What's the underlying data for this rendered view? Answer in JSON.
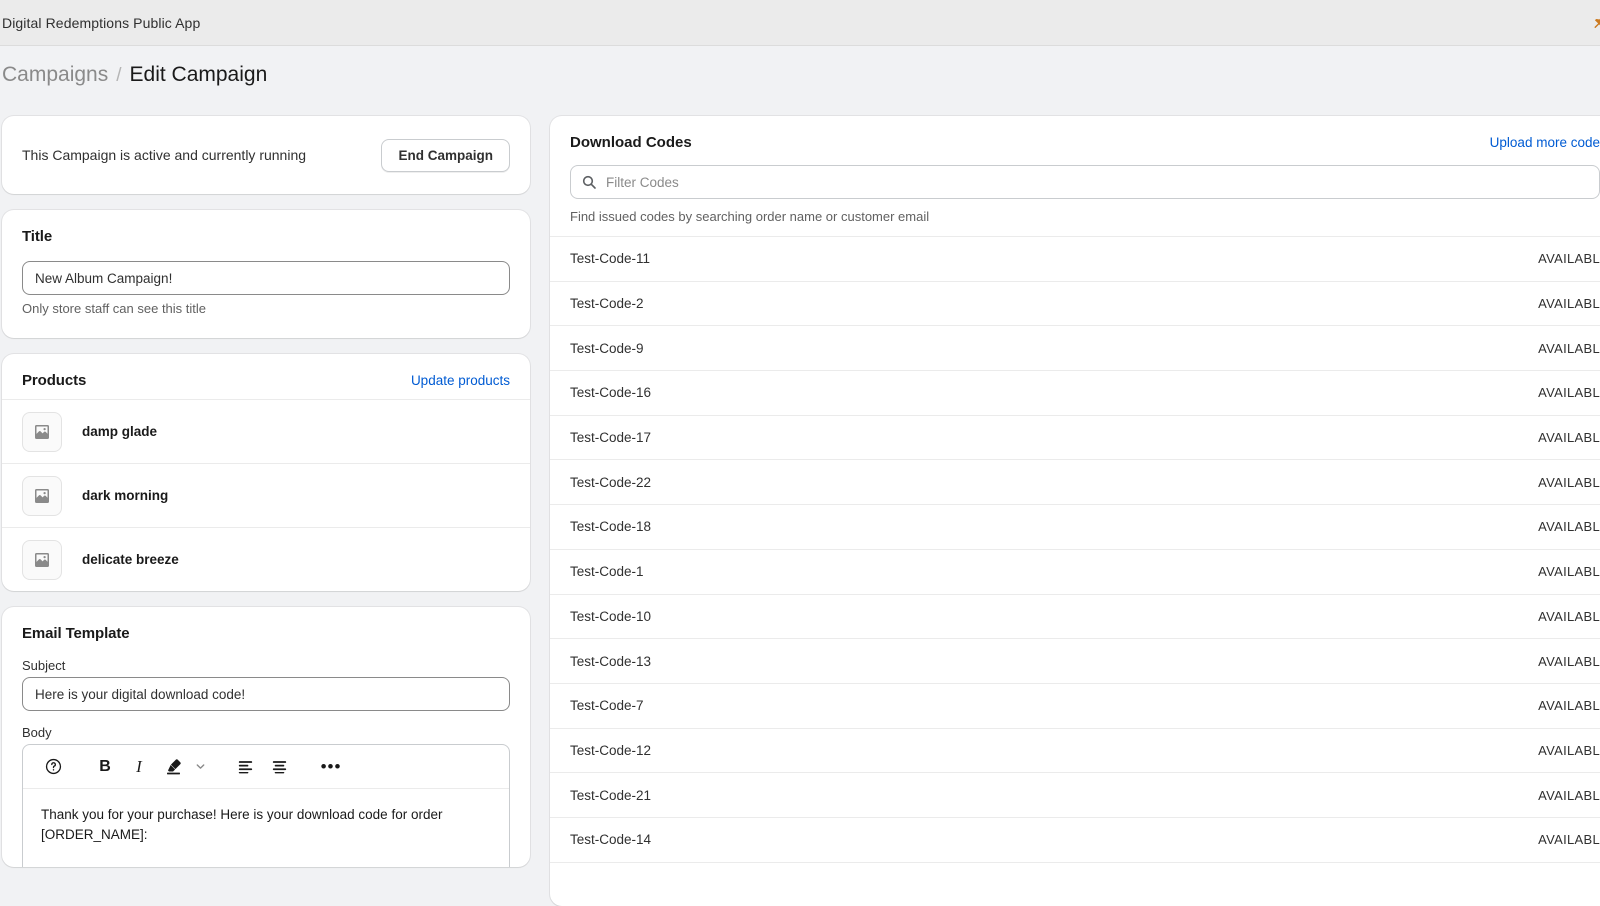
{
  "topbar": {
    "app_title": "Digital Redemptions Public App",
    "pin_icon": "pin-icon",
    "pin_color": "#cc7a1f"
  },
  "breadcrumb": {
    "parent": "Campaigns",
    "separator": "/",
    "current": "Edit Campaign"
  },
  "status_card": {
    "message": "This Campaign is active and currently running",
    "end_button": "End Campaign"
  },
  "title_card": {
    "heading": "Title",
    "value": "New Album Campaign!",
    "placeholder": "Title",
    "help": "Only store staff can see this title"
  },
  "products_card": {
    "heading": "Products",
    "update_link": "Update products",
    "items": [
      {
        "title": "damp glade",
        "thumb_icon": "image-placeholder-icon"
      },
      {
        "title": "dark morning",
        "thumb_icon": "image-placeholder-icon"
      },
      {
        "title": "delicate breeze",
        "thumb_icon": "image-placeholder-icon"
      }
    ]
  },
  "email_card": {
    "heading": "Email Template",
    "subject_label": "Subject",
    "subject_value": "Here is your digital download code!",
    "subject_placeholder": "Subject",
    "body_label": "Body",
    "toolbar": [
      {
        "name": "help-icon",
        "label": "?"
      },
      {
        "name": "bold-icon",
        "label": "B"
      },
      {
        "name": "italic-icon",
        "label": "I"
      },
      {
        "name": "highlighter-icon",
        "label": ""
      },
      {
        "name": "chevron-down-icon",
        "label": ""
      },
      {
        "name": "align-left-icon",
        "label": ""
      },
      {
        "name": "align-center-icon",
        "label": ""
      },
      {
        "name": "more-options-icon",
        "label": "•••"
      }
    ],
    "body_text": "Thank you for your purchase! Here is your download code for order [ORDER_NAME]:"
  },
  "codes_card": {
    "heading": "Download Codes",
    "upload_link": "Upload more code",
    "search_placeholder": "Filter Codes",
    "search_value": "",
    "search_icon": "search-icon",
    "help": "Find issued codes by searching order name or customer email",
    "status_label": "AVAILABL",
    "rows": [
      {
        "code": "Test-Code-11",
        "status": "AVAILABL"
      },
      {
        "code": "Test-Code-2",
        "status": "AVAILABL"
      },
      {
        "code": "Test-Code-9",
        "status": "AVAILABL"
      },
      {
        "code": "Test-Code-16",
        "status": "AVAILABL"
      },
      {
        "code": "Test-Code-17",
        "status": "AVAILABL"
      },
      {
        "code": "Test-Code-22",
        "status": "AVAILABL"
      },
      {
        "code": "Test-Code-18",
        "status": "AVAILABL"
      },
      {
        "code": "Test-Code-1",
        "status": "AVAILABL"
      },
      {
        "code": "Test-Code-10",
        "status": "AVAILABL"
      },
      {
        "code": "Test-Code-13",
        "status": "AVAILABL"
      },
      {
        "code": "Test-Code-7",
        "status": "AVAILABL"
      },
      {
        "code": "Test-Code-12",
        "status": "AVAILABL"
      },
      {
        "code": "Test-Code-21",
        "status": "AVAILABL"
      },
      {
        "code": "Test-Code-14",
        "status": "AVAILABL"
      }
    ]
  },
  "colors": {
    "page_background": "#f1f2f4",
    "card_background": "#ffffff",
    "topbar_background": "#ebebeb",
    "link_blue": "#005bd3",
    "text_primary": "#1a1a1a",
    "text_secondary": "#616161",
    "border": "#ebebeb",
    "accent_orange": "#cc7a1f"
  }
}
